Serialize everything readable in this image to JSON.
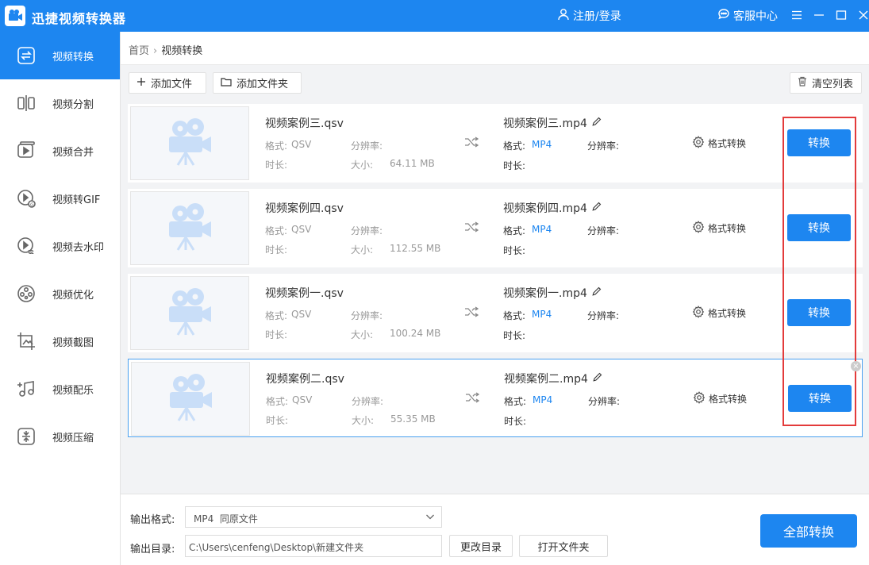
{
  "app": {
    "title": "迅捷视频转换器",
    "login": "注册/登录",
    "service": "客服中心"
  },
  "sidebar": {
    "items": [
      {
        "label": "视频转换",
        "icon": "convert-icon"
      },
      {
        "label": "视频分割",
        "icon": "split-icon"
      },
      {
        "label": "视频合并",
        "icon": "merge-icon"
      },
      {
        "label": "视频转GIF",
        "icon": "gif-icon"
      },
      {
        "label": "视频去水印",
        "icon": "watermark-icon"
      },
      {
        "label": "视频优化",
        "icon": "optimize-icon"
      },
      {
        "label": "视频截图",
        "icon": "screenshot-icon"
      },
      {
        "label": "视频配乐",
        "icon": "music-icon"
      },
      {
        "label": "视频压缩",
        "icon": "compress-icon"
      }
    ]
  },
  "breadcrumb": {
    "home": "首页",
    "sep": "›",
    "current": "视频转换"
  },
  "toolbar": {
    "add_file": "添加文件",
    "add_folder": "添加文件夹",
    "clear_list": "清空列表"
  },
  "labels": {
    "format": "格式:",
    "resolution": "分辨率:",
    "duration": "时长:",
    "size": "大小:",
    "format_convert": "格式转换",
    "convert": "转换"
  },
  "files": [
    {
      "src_name": "视频案例三.qsv",
      "src_format": "QSV",
      "size": "64.11 MB",
      "dst_name": "视频案例三.mp4",
      "dst_format": "MP4"
    },
    {
      "src_name": "视频案例四.qsv",
      "src_format": "QSV",
      "size": "112.55 MB",
      "dst_name": "视频案例四.mp4",
      "dst_format": "MP4"
    },
    {
      "src_name": "视频案例一.qsv",
      "src_format": "QSV",
      "size": "100.24 MB",
      "dst_name": "视频案例一.mp4",
      "dst_format": "MP4"
    },
    {
      "src_name": "视频案例二.qsv",
      "src_format": "QSV",
      "size": "55.35 MB",
      "dst_name": "视频案例二.mp4",
      "dst_format": "MP4"
    }
  ],
  "bottom": {
    "output_format_label": "输出格式:",
    "output_format_value": "MP4  同原文件",
    "output_dir_label": "输出目录:",
    "output_dir_value": "C:\\Users\\cenfeng\\Desktop\\新建文件夹",
    "change_dir": "更改目录",
    "open_folder": "打开文件夹",
    "convert_all": "全部转换"
  },
  "colors": {
    "accent": "#1d86f0",
    "highlight": "#e33b3b"
  }
}
